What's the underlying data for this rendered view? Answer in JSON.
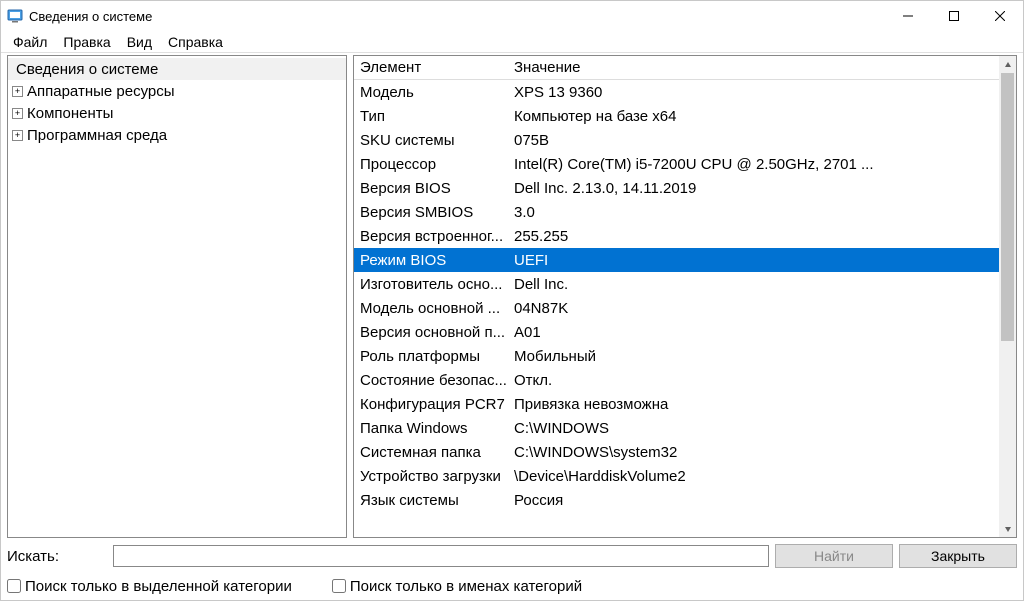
{
  "window": {
    "title": "Сведения о системе"
  },
  "menu": {
    "file": "Файл",
    "edit": "Правка",
    "view": "Вид",
    "help": "Справка"
  },
  "tree": {
    "root": "Сведения о системе",
    "items": [
      "Аппаратные ресурсы",
      "Компоненты",
      "Программная среда"
    ]
  },
  "list": {
    "headers": {
      "element": "Элемент",
      "value": "Значение"
    },
    "rows": [
      {
        "k": "Модель",
        "v": "XPS 13 9360"
      },
      {
        "k": "Тип",
        "v": "Компьютер на базе x64"
      },
      {
        "k": "SKU системы",
        "v": "075B"
      },
      {
        "k": "Процессор",
        "v": "Intel(R) Core(TM) i5-7200U CPU @ 2.50GHz, 2701 ..."
      },
      {
        "k": "Версия BIOS",
        "v": "Dell Inc. 2.13.0, 14.11.2019"
      },
      {
        "k": "Версия SMBIOS",
        "v": "3.0"
      },
      {
        "k": "Версия встроенног...",
        "v": "255.255"
      },
      {
        "k": "Режим BIOS",
        "v": "UEFI",
        "selected": true
      },
      {
        "k": "Изготовитель осно...",
        "v": "Dell Inc."
      },
      {
        "k": "Модель основной ...",
        "v": "04N87K"
      },
      {
        "k": "Версия основной п...",
        "v": "A01"
      },
      {
        "k": "Роль платформы",
        "v": "Мобильный"
      },
      {
        "k": "Состояние безопас...",
        "v": "Откл."
      },
      {
        "k": "Конфигурация PCR7",
        "v": "Привязка невозможна"
      },
      {
        "k": "Папка Windows",
        "v": "C:\\WINDOWS"
      },
      {
        "k": "Системная папка",
        "v": "C:\\WINDOWS\\system32"
      },
      {
        "k": "Устройство загрузки",
        "v": "\\Device\\HarddiskVolume2"
      },
      {
        "k": "Язык системы",
        "v": "Россия"
      }
    ]
  },
  "search": {
    "label": "Искать:",
    "find_btn": "Найти",
    "close_btn": "Закрыть",
    "chk_selected": "Поиск только в выделенной категории",
    "chk_names": "Поиск только в именах категорий"
  }
}
